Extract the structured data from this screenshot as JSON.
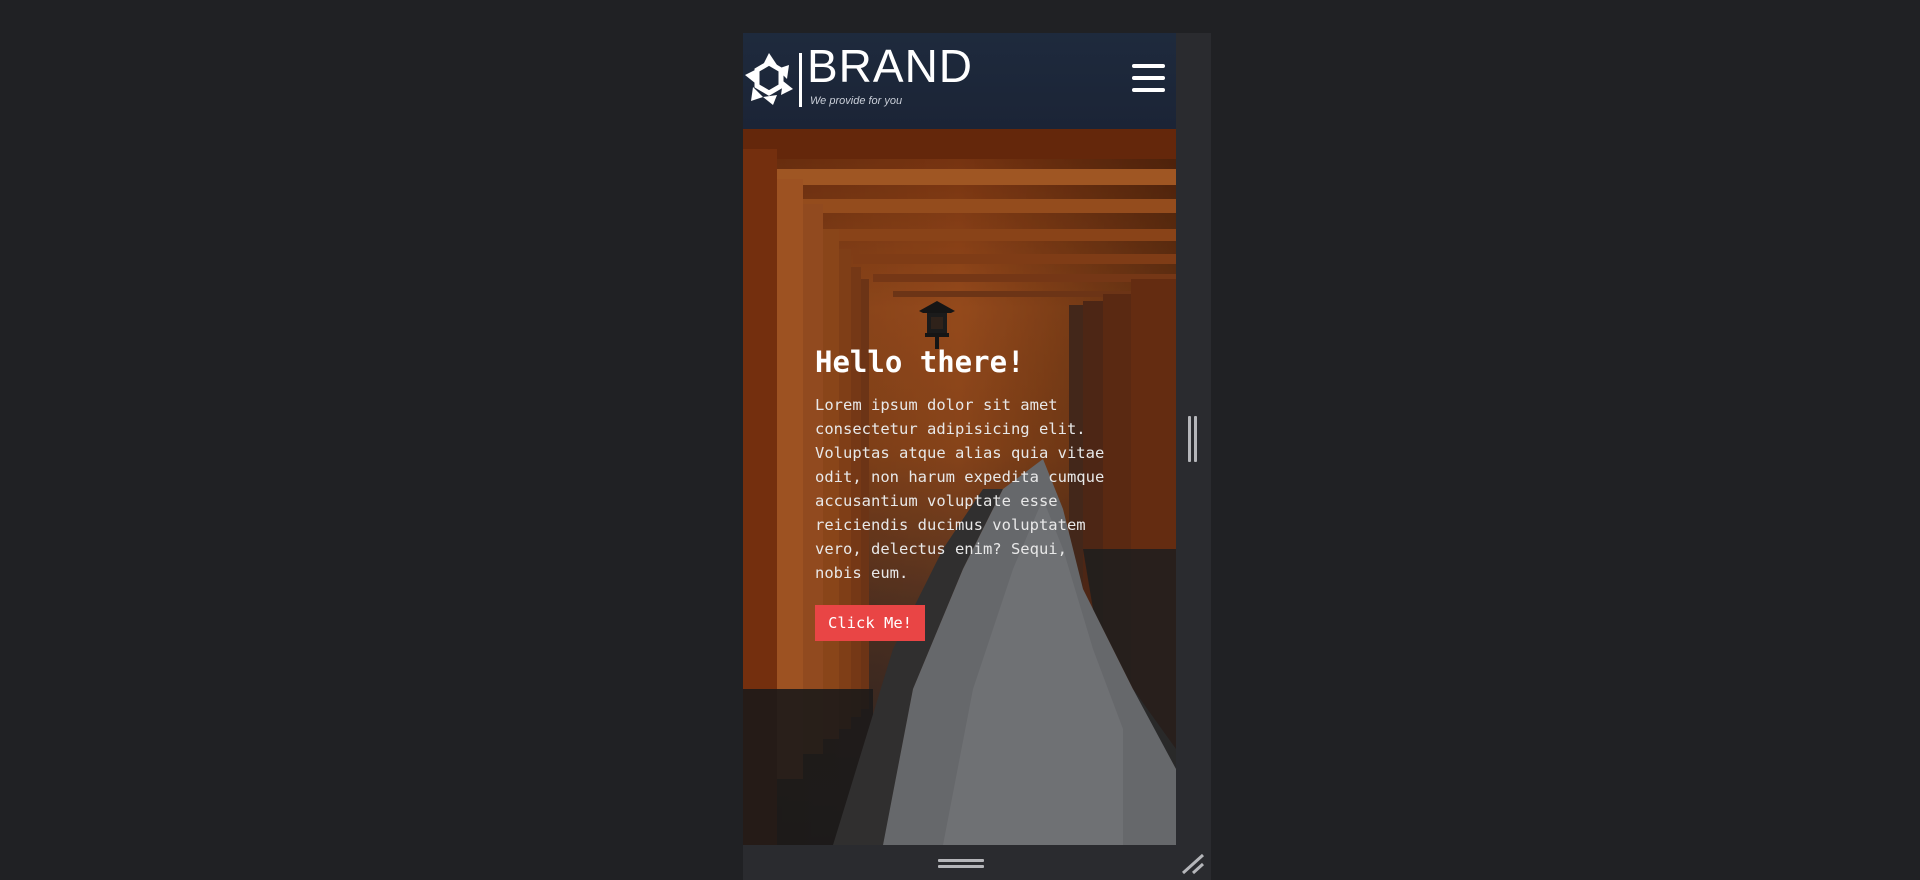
{
  "header": {
    "brand_name": "BRAND",
    "tagline": "We provide for you",
    "logo_icon": "star-logo-icon",
    "menu_icon": "hamburger-menu-icon"
  },
  "hero": {
    "title": "Hello there!",
    "text": "Lorem ipsum dolor sit amet consectetur adipisicing elit. Voluptas atque alias quia vitae odit, non harum expedita cumque accusantium voluptate esse reiciendis ducimus voluptatem vero, delectus enim? Sequi, nobis eum.",
    "button_label": "Click Me!",
    "background_image": "torii-gates-path-photo"
  },
  "device_frame": {
    "side_handle_icon": "resize-handle-vertical-icon",
    "bottom_handle_icon": "resize-handle-horizontal-icon",
    "corner_handle_icon": "resize-corner-icon"
  },
  "colors": {
    "page_background": "#202124",
    "navbar": "#1e2a3d",
    "button": "#e94545"
  }
}
